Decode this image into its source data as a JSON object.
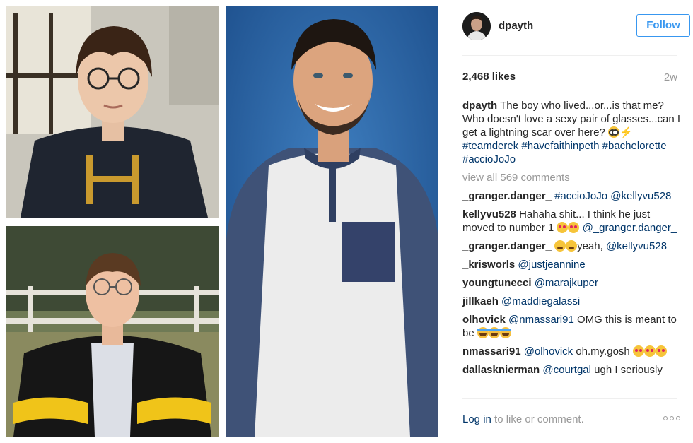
{
  "post": {
    "username": "dpayth",
    "follow_label": "Follow",
    "likes": "2,468 likes",
    "age": "2w",
    "caption": {
      "user": "dpayth",
      "text": " The boy who lived...or...is that me? Who doesn't love a sexy pair of glasses...can I get a lightning scar over here? ",
      "tags": [
        "#teamderek",
        "#havefaithinpeth",
        "#bachelorette",
        "#accioJoJo"
      ]
    },
    "view_all": "view all 569 comments",
    "comments": [
      {
        "user": "_granger.danger_",
        "text": "",
        "tags": [
          "#accioJoJo",
          "@kellyvu528"
        ]
      },
      {
        "user": "kellyvu528",
        "text": "Hahaha shit... I think he just moved to number 1 ",
        "tags": [
          "@_granger.danger_"
        ]
      },
      {
        "user": "_granger.danger_",
        "text": "yeah, ",
        "tags": [
          "@kellyvu528"
        ]
      },
      {
        "user": "_krisworls",
        "text": "",
        "tags": [
          "@justjeannine"
        ]
      },
      {
        "user": "youngtunecci",
        "text": "",
        "tags": [
          "@marajkuper"
        ]
      },
      {
        "user": "jillkaeh",
        "text": "",
        "tags": [
          "@maddiegalassi"
        ]
      },
      {
        "user": "olhovick",
        "text": " OMG this is meant to be ",
        "tags": [
          "@nmassari91"
        ]
      },
      {
        "user": "nmassari91",
        "text": " oh.my.gosh ",
        "tags": [
          "@olhovick"
        ]
      },
      {
        "user": "dallasknierman",
        "text": " ugh I seriously",
        "tags": [
          "@courtgal"
        ]
      }
    ],
    "footer": {
      "login": "Log in",
      "rest": " to like or comment."
    }
  },
  "icons": {
    "more": "more-options-icon",
    "bolt": "lightning-bolt-icon"
  },
  "colors": {
    "follow_blue": "#3897f0",
    "link": "#003569",
    "muted": "#999999"
  }
}
